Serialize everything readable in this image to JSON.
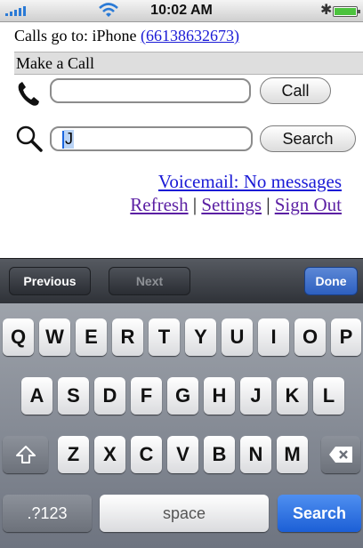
{
  "status_bar": {
    "time": "10:02 AM"
  },
  "web": {
    "calls_go_to_prefix": "Calls go to: iPhone ",
    "calls_go_to_number": "(66138632673)",
    "section_title": "Make a Call",
    "call_input_value": "",
    "call_button": "Call",
    "search_input_value": "J",
    "search_button": "Search",
    "voicemail_link": "Voicemail: No messages",
    "refresh_link": "Refresh",
    "settings_link": "Settings",
    "signout_link": "Sign Out",
    "separator": "|"
  },
  "form_assistant": {
    "previous": "Previous",
    "next": "Next",
    "done": "Done"
  },
  "keyboard": {
    "row1": [
      "Q",
      "W",
      "E",
      "R",
      "T",
      "Y",
      "U",
      "I",
      "O",
      "P"
    ],
    "row2": [
      "A",
      "S",
      "D",
      "F",
      "G",
      "H",
      "J",
      "K",
      "L"
    ],
    "row3": [
      "Z",
      "X",
      "C",
      "V",
      "B",
      "N",
      "M"
    ],
    "numbers_key": ".?123",
    "space_key": "space",
    "search_key": "Search"
  },
  "colors": {
    "link": "#1a1ad6",
    "visited_link": "#5b1fa3",
    "keyboard_accent": "#1c5fd6"
  }
}
